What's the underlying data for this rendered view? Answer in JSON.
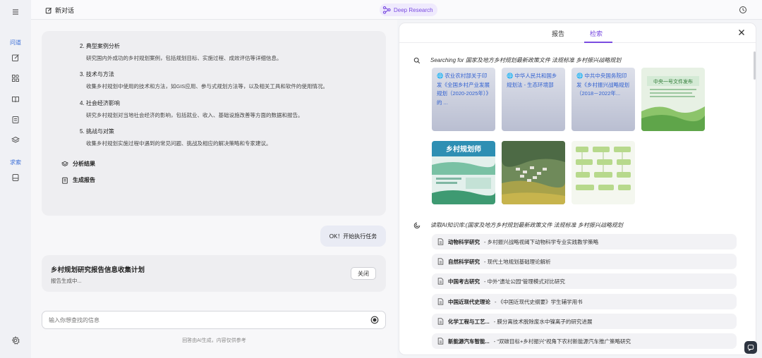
{
  "sidebar": {
    "section_wenda": "问道",
    "section_qiusuo": "求索",
    "icons": [
      "menu-icon",
      "edit-icon",
      "grid-icon",
      "book-icon",
      "database-icon",
      "layers-icon",
      "storage-icon",
      "settings-icon"
    ]
  },
  "header": {
    "new_chat": "新对话",
    "deep_research": "Deep Research"
  },
  "plan": {
    "steps": [
      {
        "title": "2. 典型案例分析",
        "desc": "研究国内外成功的乡村规划案例，包括规划目标、实施过程、成效评估等详细信息。"
      },
      {
        "title": "3. 技术与方法",
        "desc": "收集乡村规划中使用的技术和方法，如GIS应用、参与式规划方法等，以及相关工具和软件的使用情况。"
      },
      {
        "title": "4. 社会经济影响",
        "desc": "研究乡村规划对当地社会经济的影响，包括就业、收入、基础设施改善等方面的数据和报告。"
      },
      {
        "title": "5. 挑战与对策",
        "desc": "收集乡村规划实施过程中遇到的常见问题、挑战及相应的解决策略和专家建议。"
      }
    ],
    "actions": [
      "分析结果",
      "生成报告"
    ]
  },
  "chat": {
    "user_message": "OK！开始执行任务",
    "status_title": "乡村规划研究报告信息收集计划",
    "status_sub": "报告生成中...",
    "close_label": "关闭",
    "input_placeholder": "输入你想查找的信息",
    "disclaimer": "回答由AI生成，内容仅供参考"
  },
  "panel": {
    "tabs": [
      "报告",
      "检索"
    ],
    "active_tab": "检索",
    "search_prefix": "Searching for",
    "search_query": "国家及地方乡村规划最新政策文件 法规标准 乡村振兴战略规划",
    "results": [
      {
        "text": "🌐 农业农村部关于印发《全国乡村产业发展规划（2020-2025年）》的 ..."
      },
      {
        "text": "🌐 中华人民共和国乡规划法 - 生态环境部"
      },
      {
        "text": "🌐 中共中央国务院印发《乡村振兴战略规划（2018－2022年..."
      }
    ],
    "kb_label": "读取AI知识库:",
    "kb_query": "(国家及地方乡村规划最新政策文件 法规标准 乡村振兴战略规划",
    "docs": [
      {
        "title": "动物科学研究",
        "sub": "- 乡村振兴战略视阈下动物科学专业实践教学策略"
      },
      {
        "title": "自然科学研究",
        "sub": "- 现代土地规划基础理论解析"
      },
      {
        "title": "中国考古研究",
        "sub": "- 中外\"遗址公园\"管理模式对比研究"
      },
      {
        "title": "中国近现代史理论",
        "sub": "- 《中国近现代史纲要》学生辅学用书"
      },
      {
        "title": "化学工程与工艺...",
        "sub": "- 膜分离技术脱除废水中镍离子的研究进展"
      },
      {
        "title": "新能源汽车智能...",
        "sub": "- \"双碳目标+乡村振兴\"视角下农村新能源汽车推广策略研究"
      }
    ],
    "thumbnails": [
      {
        "name": "thumb-document-green",
        "heading": "中央一号文件发布"
      },
      {
        "name": "thumb-planner-poster",
        "heading": "乡村规划师"
      },
      {
        "name": "thumb-village-aerial"
      },
      {
        "name": "thumb-flowchart"
      }
    ]
  },
  "colors": {
    "accent": "#7a4ce0",
    "link": "#2f5fd0",
    "rail_label": "#3b6fd8"
  }
}
